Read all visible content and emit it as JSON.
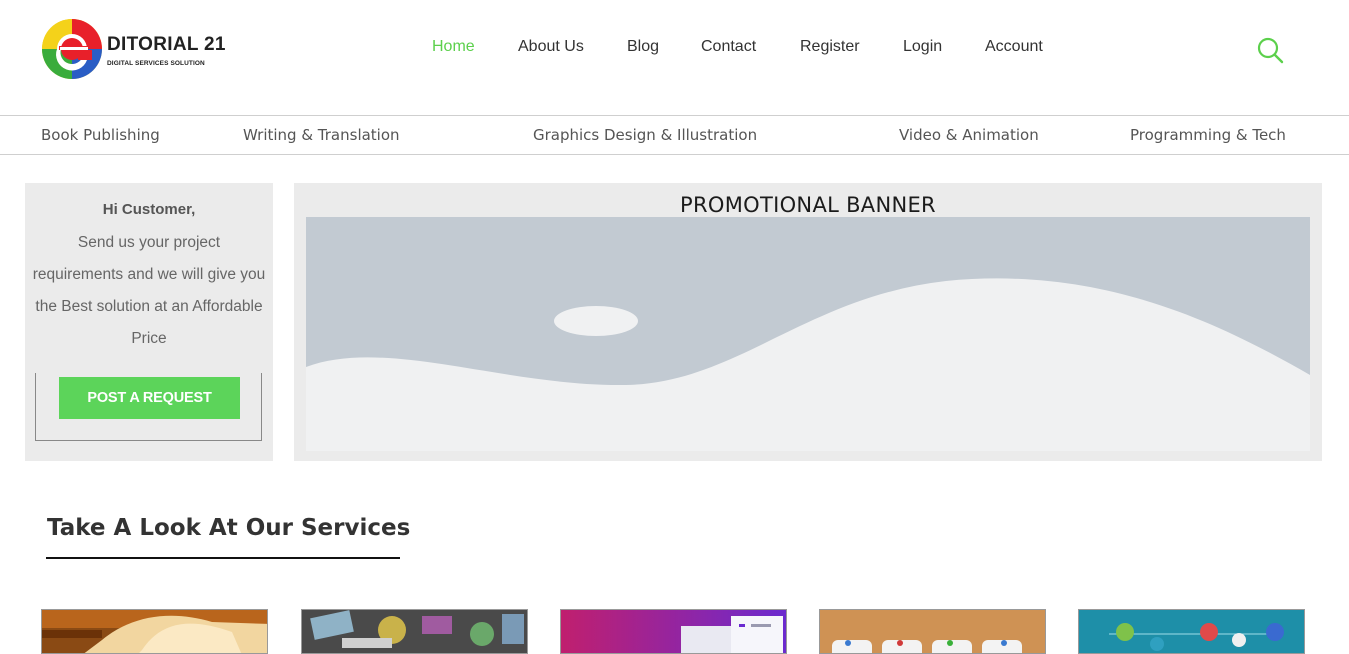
{
  "brand": {
    "name": "DITORIAL 21",
    "tagline": "DIGITAL SERVICES SOLUTION",
    "colors": {
      "red": "#e8202a",
      "yellow": "#f4d21a",
      "green": "#3aac3c",
      "blue": "#2a5dc5"
    }
  },
  "nav": {
    "items": [
      {
        "label": "Home",
        "active": true
      },
      {
        "label": "About Us",
        "active": false
      },
      {
        "label": "Blog",
        "active": false
      },
      {
        "label": "Contact",
        "active": false
      },
      {
        "label": "Register",
        "active": false
      },
      {
        "label": "Login",
        "active": false
      },
      {
        "label": "Account",
        "active": false
      }
    ],
    "accent": "#5cd04c",
    "search_icon": "search-icon"
  },
  "categories": [
    "Book Publishing",
    "Writing & Translation",
    "Graphics Design & Illustration",
    "Video & Animation",
    "Programming & Tech"
  ],
  "customer_box": {
    "greeting": "Hi Customer,",
    "message": "Send us your project requirements and we will give you the Best solution at an Affordable Price",
    "button_label": "POST A REQUEST"
  },
  "promo": {
    "title": "PROMOTIONAL BANNER",
    "image_icon": "image-placeholder-icon"
  },
  "services": {
    "heading": "Take A Look At Our Services",
    "thumbnails": [
      {
        "icon": "book-image"
      },
      {
        "icon": "graffiti-image"
      },
      {
        "icon": "design-app-image"
      },
      {
        "icon": "cork-board-image"
      },
      {
        "icon": "tech-network-image"
      }
    ]
  }
}
